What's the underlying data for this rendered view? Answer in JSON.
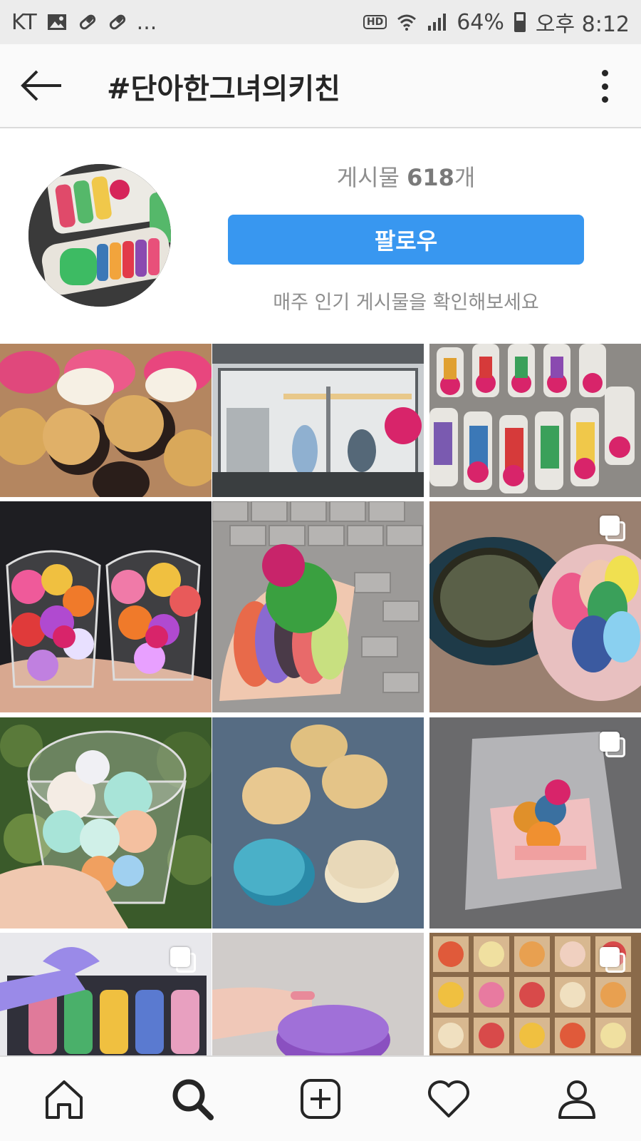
{
  "status_bar": {
    "carrier": "KT",
    "dots": "...",
    "hd": "HD",
    "battery": "64%",
    "time": "오후 8:12"
  },
  "header": {
    "title": "#단아한그녀의키친",
    "back_icon": "arrow-left-icon",
    "more_icon": "more-vertical-icon"
  },
  "profile": {
    "posts_label": "게시물",
    "posts_count": "618",
    "posts_unit": "개",
    "follow_label": "팔로우",
    "hint": "매주 인기 게시물을 확인해보세요"
  },
  "grid": {
    "tiles": [
      {
        "subject": "macarons-tray",
        "multi": false
      },
      {
        "subject": "shop-front",
        "multi": false
      },
      {
        "subject": "macaron-boxes",
        "multi": false
      },
      {
        "subject": "meringue-cups",
        "multi": false
      },
      {
        "subject": "macaron-bag",
        "multi": false
      },
      {
        "subject": "coffee-macarons",
        "multi": true
      },
      {
        "subject": "meringue-cup-plants",
        "multi": false
      },
      {
        "subject": "cookie-bags",
        "multi": false
      },
      {
        "subject": "gift-bag",
        "multi": true
      },
      {
        "subject": "ribbon-box",
        "multi": true
      },
      {
        "subject": "purple-macaron",
        "multi": false
      },
      {
        "subject": "tarts-box",
        "multi": true
      }
    ]
  },
  "bottom_nav": {
    "items": [
      "home-icon",
      "search-icon",
      "add-post-icon",
      "heart-icon",
      "profile-icon"
    ]
  },
  "colors": {
    "accent": "#3897f0",
    "text": "#262626",
    "muted": "#8e8e8e",
    "divider": "#dbdbdb"
  }
}
